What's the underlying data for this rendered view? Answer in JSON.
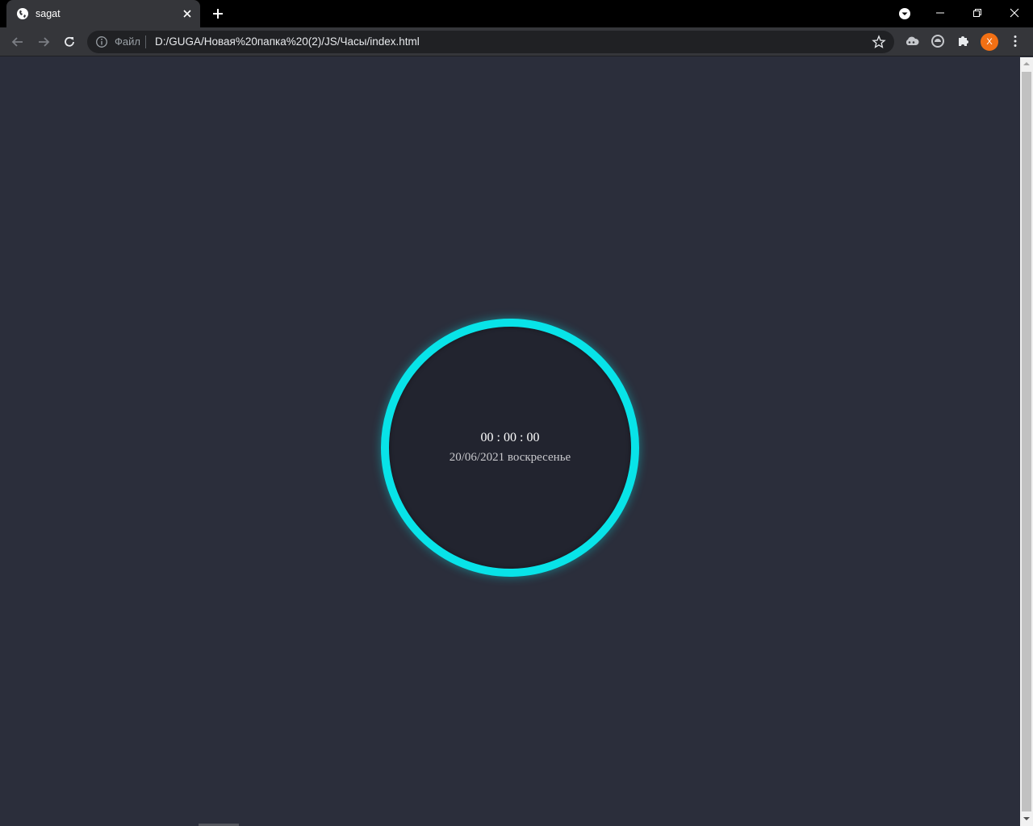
{
  "browser": {
    "tab": {
      "title": "sagat",
      "favicon": "globe-icon"
    },
    "omnibox": {
      "scheme_label": "Файл",
      "url": "D:/GUGA/Новая%20папка%20(2)/JS/Часы/index.html"
    },
    "profile": {
      "initial": "X",
      "color": "#f27014"
    }
  },
  "page": {
    "background": "#2b2e3b",
    "clock": {
      "time": "00 : 00 : 00",
      "date": "20/06/2021 воскресенье",
      "ring_color": "#08e3e8",
      "face_color": "#22242f"
    }
  }
}
